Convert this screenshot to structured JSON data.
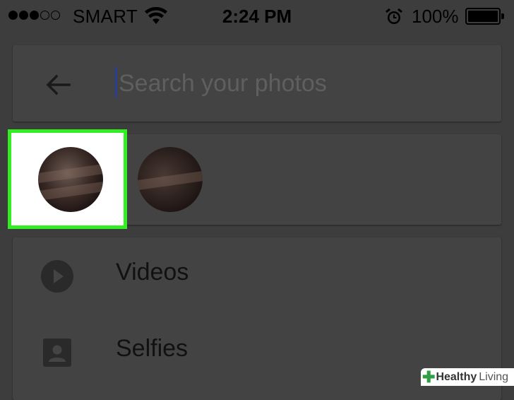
{
  "status_bar": {
    "carrier": "SMART",
    "time": "2:24 PM",
    "battery_percent": "100%",
    "signal_bars_filled": 3,
    "signal_bars_total": 5,
    "battery_level": 1.0
  },
  "search": {
    "placeholder": "Search your photos",
    "value": "",
    "back_icon": "arrow-back-icon"
  },
  "people": {
    "faces": [
      "face-thumbnail-1",
      "face-thumbnail-2"
    ],
    "highlight_color": "#33ee22"
  },
  "list": {
    "items": [
      {
        "label": "Videos",
        "icon": "play-circle-icon"
      },
      {
        "label": "Selfies",
        "icon": "portrait-icon"
      }
    ]
  },
  "watermark": {
    "word1": "Healthy",
    "word2": "Living",
    "logo_icon": "green-plus-icon"
  },
  "colors": {
    "background": "#3d3d3d",
    "card": "#434343",
    "highlight": "#33ee22",
    "cursor": "#2a3f8f"
  }
}
